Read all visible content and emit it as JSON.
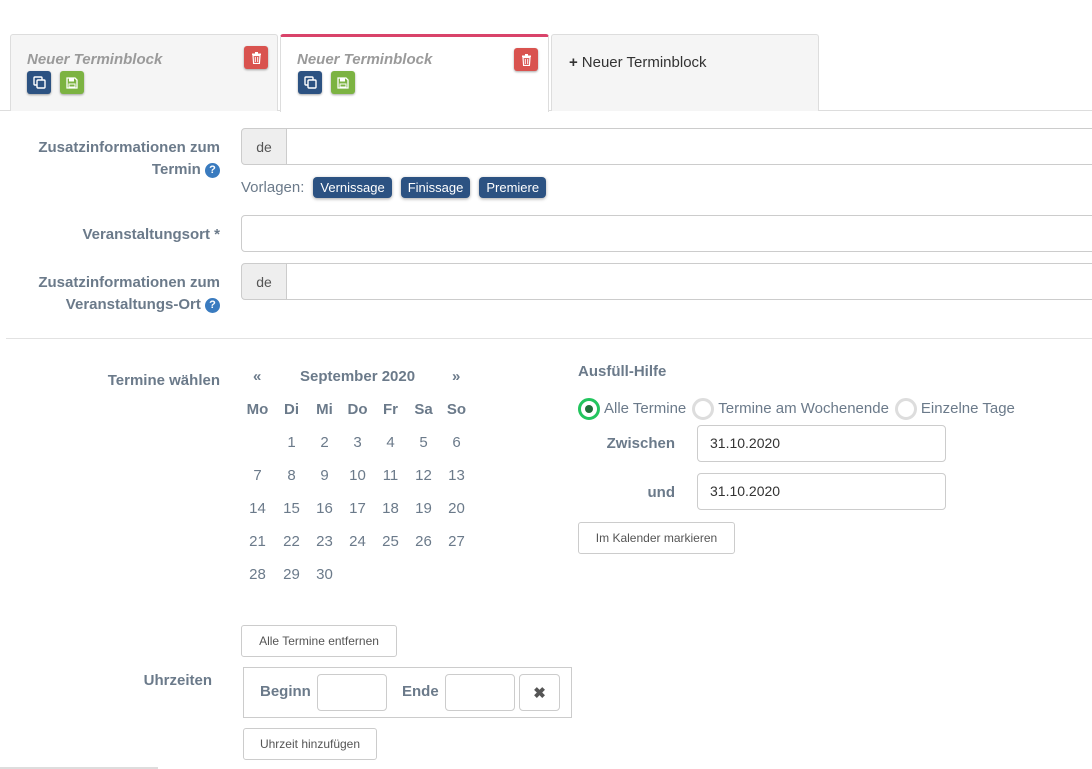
{
  "tabs": [
    {
      "title": "Neuer Terminblock"
    },
    {
      "title": "Neuer Terminblock"
    }
  ],
  "new_tab": {
    "plus": "+",
    "label": "Neuer Terminblock"
  },
  "form": {
    "zusatz_termin": {
      "label_line1": "Zusatzinformationen zum",
      "label_line2": "Termin",
      "lang": "de",
      "value": ""
    },
    "vorlagen": {
      "label": "Vorlagen:",
      "tags": [
        "Vernissage",
        "Finissage",
        "Premiere"
      ]
    },
    "veranstaltungsort": {
      "label": "Veranstaltungsort *",
      "value": ""
    },
    "zusatz_ort": {
      "label_line1": "Zusatzinformationen zum",
      "label_line2": "Veranstaltungs-Ort",
      "lang": "de",
      "value": ""
    }
  },
  "termine": {
    "label": "Termine wählen",
    "calendar": {
      "prev": "«",
      "next": "»",
      "month": "September 2020",
      "weekdays": [
        "Mo",
        "Di",
        "Mi",
        "Do",
        "Fr",
        "Sa",
        "So"
      ],
      "weeks": [
        [
          "",
          "1",
          "2",
          "3",
          "4",
          "5",
          "6"
        ],
        [
          "7",
          "8",
          "9",
          "10",
          "11",
          "12",
          "13"
        ],
        [
          "14",
          "15",
          "16",
          "17",
          "18",
          "19",
          "20"
        ],
        [
          "21",
          "22",
          "23",
          "24",
          "25",
          "26",
          "27"
        ],
        [
          "28",
          "29",
          "30",
          "",
          "",
          "",
          ""
        ]
      ]
    },
    "remove_all_button": "Alle Termine entfernen"
  },
  "helper": {
    "title": "Ausfüll-Hilfe",
    "options": [
      {
        "label": "Alle Termine",
        "checked": true
      },
      {
        "label": "Termine am Wochenende",
        "checked": false
      },
      {
        "label": "Einzelne Tage",
        "checked": false
      }
    ],
    "between_label": "Zwischen",
    "between_value": "31.10.2020",
    "and_label": "und",
    "and_value": "31.10.2020",
    "mark_button": "Im Kalender markieren"
  },
  "times": {
    "label": "Uhrzeiten",
    "begin_label": "Beginn",
    "end_label": "Ende",
    "begin_value": "",
    "end_value": "",
    "remove_icon": "✖",
    "add_button": "Uhrzeit hinzufügen"
  },
  "icons": {
    "help": "?",
    "delete": "trash-icon",
    "copy": "copy-icon",
    "save": "save-icon"
  },
  "colors": {
    "accent_tab": "#d9436a",
    "primary": "#2c5282",
    "danger": "#d9534f",
    "success": "#7cb342",
    "radio_checked": "#22c55e"
  }
}
